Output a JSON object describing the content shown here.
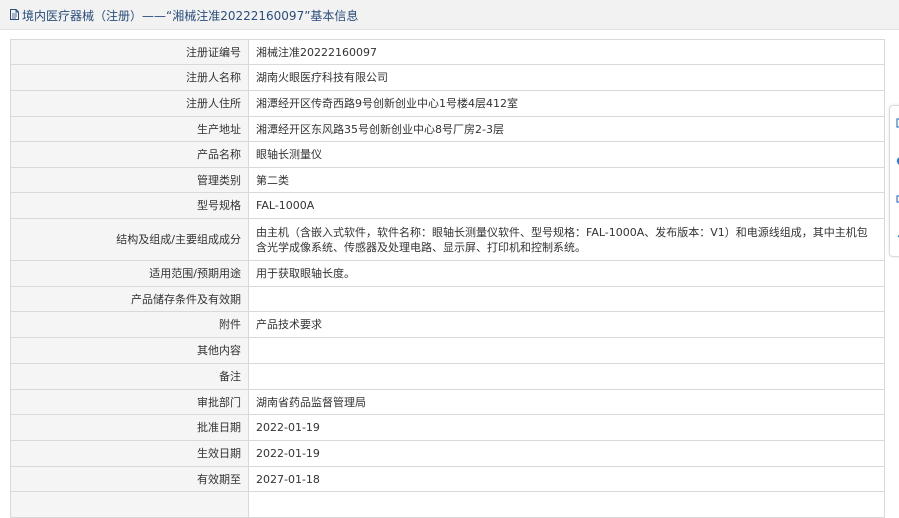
{
  "header": {
    "title": "境内医疗器械（注册）——“湘械注准20222160097”基本信息",
    "icon": "document-icon"
  },
  "rows": [
    {
      "label": "注册证编号",
      "value": "湘械注准20222160097"
    },
    {
      "label": "注册人名称",
      "value": "湖南火眼医疗科技有限公司"
    },
    {
      "label": "注册人住所",
      "value": "湘潭经开区传奇西路9号创新创业中心1号楼4层412室"
    },
    {
      "label": "生产地址",
      "value": "湘潭经开区东风路35号创新创业中心8号厂房2-3层"
    },
    {
      "label": "产品名称",
      "value": "眼轴长测量仪"
    },
    {
      "label": "管理类别",
      "value": "第二类"
    },
    {
      "label": "型号规格",
      "value": "FAL-1000A"
    },
    {
      "label": "结构及组成/主要组成成分",
      "value": "由主机（含嵌入式软件，软件名称：眼轴长测量仪软件、型号规格：FAL-1000A、发布版本：V1）和电源线组成，其中主机包含光学成像系统、传感器及处理电路、显示屏、打印机和控制系统。"
    },
    {
      "label": "适用范围/预期用途",
      "value": "用于获取眼轴长度。"
    },
    {
      "label": "产品储存条件及有效期",
      "value": ""
    },
    {
      "label": "附件",
      "value": "产品技术要求"
    },
    {
      "label": "其他内容",
      "value": ""
    },
    {
      "label": "备注",
      "value": ""
    },
    {
      "label": "审批部门",
      "value": "湖南省药品监督管理局"
    },
    {
      "label": "批准日期",
      "value": "2022-01-19"
    },
    {
      "label": "生效日期",
      "value": "2022-01-19"
    },
    {
      "label": "有效期至",
      "value": "2027-01-18"
    },
    {
      "label": "",
      "value": ""
    }
  ],
  "colors": {
    "header_bg": "#f2f2f2",
    "title_text": "#2a4d7a",
    "label_bg": "#f5f5f5",
    "border": "#d9d9d9"
  }
}
